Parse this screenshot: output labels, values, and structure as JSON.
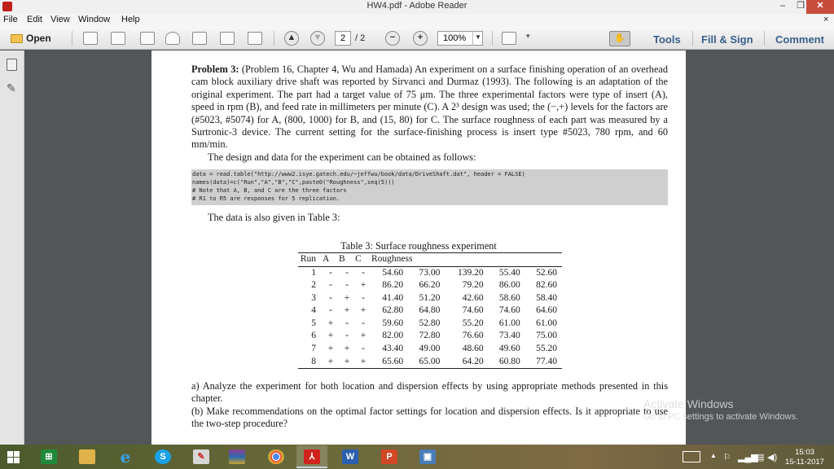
{
  "window": {
    "title": "HW4.pdf - Adobe Reader",
    "minimize": "–",
    "maximize": "❐",
    "close": "✕"
  },
  "menu": {
    "items": [
      "File",
      "Edit",
      "View",
      "Window",
      "Help"
    ],
    "close_doc": "×"
  },
  "toolbar": {
    "open_label": "Open",
    "page_current": "2",
    "page_total": "/ 2",
    "zoom": "100%",
    "tools": "Tools",
    "fill_sign": "Fill & Sign",
    "comment": "Comment"
  },
  "document": {
    "problem_label": "Problem 3:",
    "problem_text": "(Problem 16, Chapter 4, Wu and Hamada) An experiment on a surface finishing operation of an overhead cam block auxiliary drive shaft was reported by Sirvanci and Durmaz (1993). The following is an adaptation of the original experiment. The part had a target value of 75 μm. The three experimental factors were type of insert (A), speed in rpm (B), and feed rate in millimeters per minute (C). A 2³ design was used; the (−,+) levels for the factors are (#5023, #5074) for A, (800, 1000) for B, and (15, 80) for C. The surface roughness of each part was measured by a Surtronic-3 device. The current setting for the surface-finishing process is insert type #5023, 780 rpm, and 60 mm/min.",
    "design_line": "The design and data for the experiment can be obtained as follows:",
    "code": "data = read.table(\"http://www2.isye.gatech.edu/~jeffwu/book/data/DriveShaft.dat\", header = FALSE)\nnames(data)=c(\"Run\",\"A\",\"B\",\"C\",paste0(\"Roughness\",seq(5)))\n# Note that A, B, and C are the three factors\n# R1 to R5 are responses for 5 replication.",
    "data_line": "The data is also given in Table 3:",
    "table": {
      "caption": "Table 3: Surface roughness experiment",
      "headers": [
        "Run",
        "A",
        "B",
        "C",
        "Roughness"
      ],
      "rows": [
        [
          "1",
          "-",
          "-",
          "-",
          "54.60",
          "73.00",
          "139.20",
          "55.40",
          "52.60"
        ],
        [
          "2",
          "-",
          "-",
          "+",
          "86.20",
          "66.20",
          "79.20",
          "86.00",
          "82.60"
        ],
        [
          "3",
          "-",
          "+",
          "-",
          "41.40",
          "51.20",
          "42.60",
          "58.60",
          "58.40"
        ],
        [
          "4",
          "-",
          "+",
          "+",
          "62.80",
          "64.80",
          "74.60",
          "74.60",
          "64.60"
        ],
        [
          "5",
          "+",
          "-",
          "-",
          "59.60",
          "52.80",
          "55.20",
          "61.00",
          "61.00"
        ],
        [
          "6",
          "+",
          "-",
          "+",
          "82.00",
          "72.80",
          "76.60",
          "73.40",
          "75.00"
        ],
        [
          "7",
          "+",
          "+",
          "-",
          "43.40",
          "49.00",
          "48.60",
          "49.60",
          "55.20"
        ],
        [
          "8",
          "+",
          "+",
          "+",
          "65.60",
          "65.00",
          "64.20",
          "60.80",
          "77.40"
        ]
      ]
    },
    "question_a": "a) Analyze the experiment for both location and dispersion effects by using appropriate methods presented in this chapter.",
    "question_b": "(b) Make recommendations on the optimal factor settings for location and dispersion effects. Is it appropriate to use the two-step procedure?"
  },
  "watermark": {
    "line1": "Activate Windows",
    "line2": "Go to PC settings to activate Windows."
  },
  "taskbar": {
    "apps": [
      "store",
      "file-explorer",
      "internet-explorer",
      "skype",
      "paint",
      "winrar",
      "chrome",
      "adobe-reader",
      "word",
      "powerpoint",
      "remote-desktop"
    ],
    "time": "15:03",
    "date": "15-11-2017"
  },
  "colors": {
    "accent": "#3a5f8c",
    "close": "#c74c3c",
    "pdf_red": "#c0201c"
  }
}
